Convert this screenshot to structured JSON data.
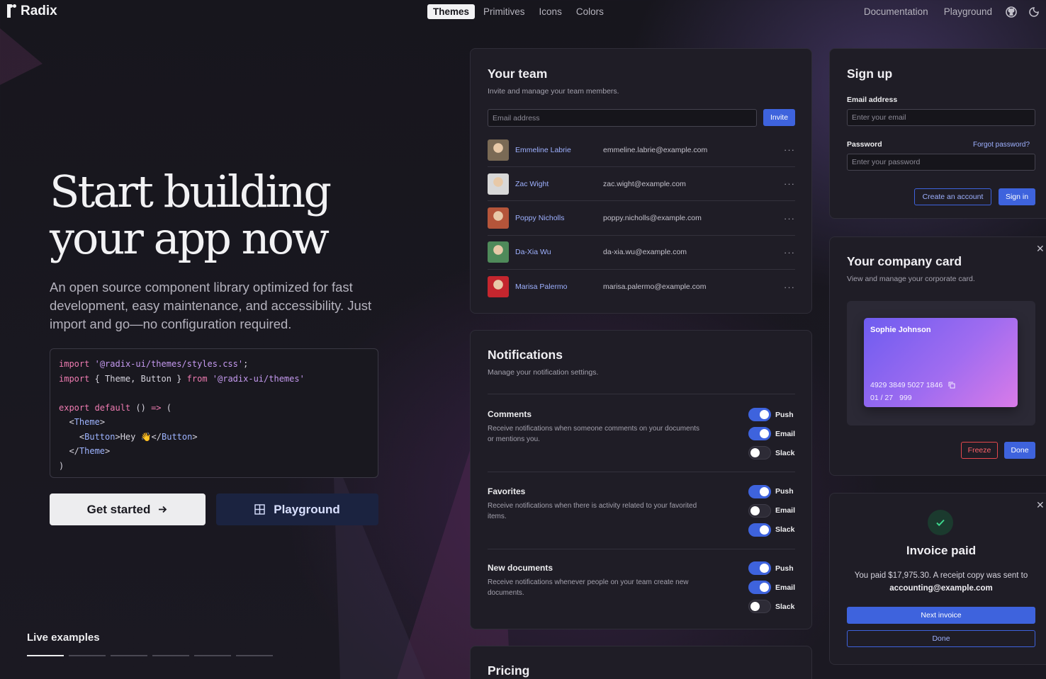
{
  "nav": {
    "brand": "Radix",
    "center": [
      "Themes",
      "Primitives",
      "Icons",
      "Colors"
    ],
    "active": "Themes",
    "right": [
      "Documentation",
      "Playground"
    ],
    "icons": [
      "github-icon",
      "theme-toggle-icon"
    ]
  },
  "hero": {
    "title_line1": "Start building",
    "title_line2": "your app now",
    "subtitle": "An open source component library optimized for fast development, easy maintenance, and accessibility. Just import and go—no configuration required.",
    "code": [
      "import '@radix-ui/themes/styles.css';",
      "import { Theme, Button } from '@radix-ui/themes'",
      "",
      "export default () => (",
      "  <Theme>",
      "    <Button>Hey 👋</Button>",
      "  </Theme>",
      ")"
    ],
    "get_started": "Get started",
    "playground": "Playground",
    "live_examples": "Live examples",
    "live_tab_count": 6
  },
  "team": {
    "title": "Your team",
    "subtitle": "Invite and manage your team members.",
    "email_placeholder": "Email address",
    "invite": "Invite",
    "more": "···",
    "members": [
      {
        "name": "Emmeline Labrie",
        "email": "emmeline.labrie@example.com",
        "color": "#7a6a55"
      },
      {
        "name": "Zac Wight",
        "email": "zac.wight@example.com",
        "color": "#d8d8d8"
      },
      {
        "name": "Poppy Nicholls",
        "email": "poppy.nicholls@example.com",
        "color": "#b5553a"
      },
      {
        "name": "Da-Xia Wu",
        "email": "da-xia.wu@example.com",
        "color": "#4f8a5a"
      },
      {
        "name": "Marisa Palermo",
        "email": "marisa.palermo@example.com",
        "color": "#c4262e"
      }
    ]
  },
  "notifications": {
    "title": "Notifications",
    "subtitle": "Manage your notification settings.",
    "groups": [
      {
        "title": "Comments",
        "desc": "Receive notifications when someone comments on your documents or mentions you.",
        "toggles": [
          {
            "label": "Push",
            "on": true
          },
          {
            "label": "Email",
            "on": true
          },
          {
            "label": "Slack",
            "on": false
          }
        ]
      },
      {
        "title": "Favorites",
        "desc": "Receive notifications when there is activity related to your favorited items.",
        "toggles": [
          {
            "label": "Push",
            "on": true
          },
          {
            "label": "Email",
            "on": false
          },
          {
            "label": "Slack",
            "on": true
          }
        ]
      },
      {
        "title": "New documents",
        "desc": "Receive notifications whenever people on your team create new documents.",
        "toggles": [
          {
            "label": "Push",
            "on": true
          },
          {
            "label": "Email",
            "on": true
          },
          {
            "label": "Slack",
            "on": false
          }
        ]
      }
    ]
  },
  "pricing": {
    "title": "Pricing"
  },
  "signup": {
    "title": "Sign up",
    "email_label": "Email address",
    "email_placeholder": "Enter your email",
    "password_label": "Password",
    "forgot": "Forgot password?",
    "password_placeholder": "Enter your password",
    "create": "Create an account",
    "signin": "Sign in"
  },
  "company_card": {
    "title": "Your company card",
    "subtitle": "View and manage your corporate card.",
    "holder": "Sophie Johnson",
    "number": "4929 3849 5027 1846",
    "expiry": "01 / 27",
    "cvc": "999",
    "freeze": "Freeze",
    "done": "Done"
  },
  "invoice": {
    "title": "Invoice paid",
    "text": "You paid $17,975.30. A receipt copy was sent to",
    "email": "accounting@example.com",
    "next": "Next invoice",
    "done": "Done"
  },
  "colors": {
    "accent": "#3e63dd",
    "red": "#e5484d",
    "green": "#3dd68c"
  }
}
